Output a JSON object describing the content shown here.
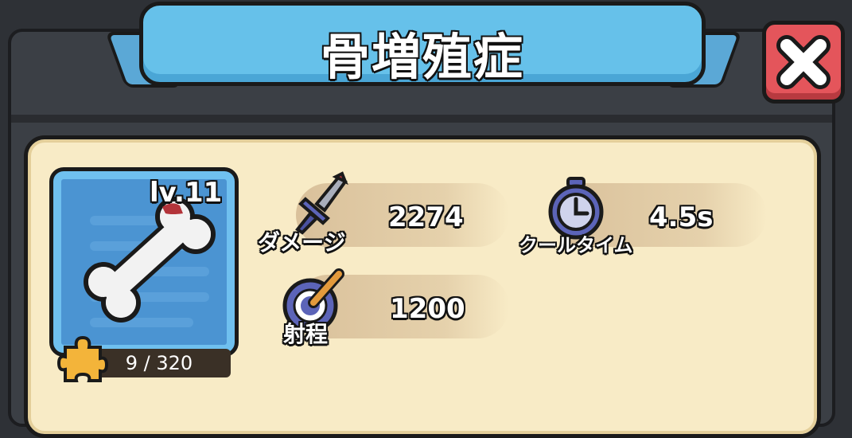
{
  "dialog": {
    "title": "骨増殖症"
  },
  "item": {
    "icon": "bone-icon",
    "level": "lv.11",
    "fragments": "9 / 320",
    "fragments_current": 9,
    "fragments_required": 320
  },
  "stats": {
    "damage": {
      "label": "ダメージ",
      "value": "2274",
      "icon": "dagger-icon"
    },
    "cooldown": {
      "label": "クールタイム",
      "value": "4.5s",
      "icon": "stopwatch-icon"
    },
    "range": {
      "label": "射程",
      "value": "1200",
      "icon": "target-icon"
    }
  },
  "colors": {
    "ribbon": "#66c1ea",
    "close": "#e4555b",
    "panel": "#f8ebc6",
    "card": "#4b94d2"
  }
}
